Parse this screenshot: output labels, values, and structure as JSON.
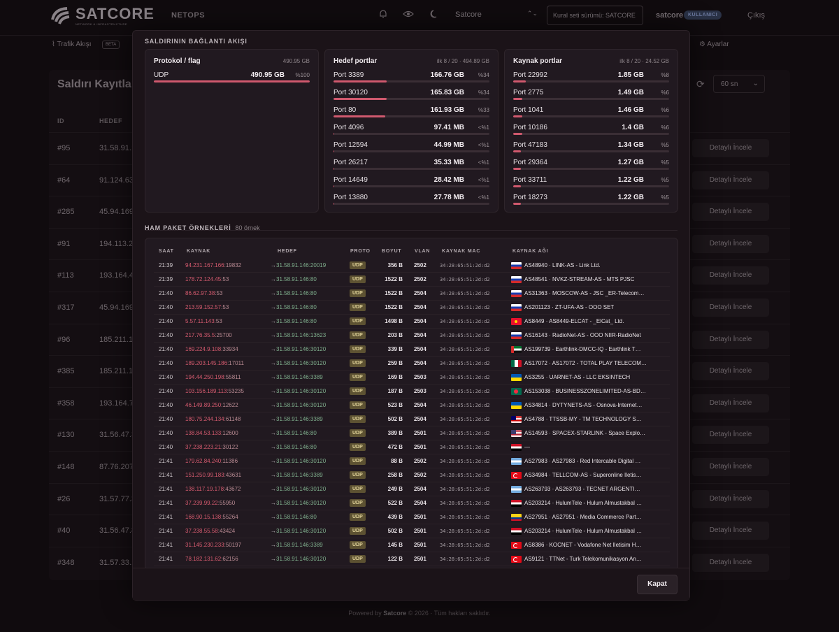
{
  "app": {
    "brand": "SATCORE",
    "brand_tagline": "NETWORK & INFRASTRUCTURE",
    "section": "NETOPS",
    "tenant": "Satcore",
    "ruleset": "Kural seti sürümü: SATCORE",
    "user": "satcore",
    "user_role": "KULLANICI",
    "logout": "Çıkış"
  },
  "subnav": {
    "traffic": "Trafik Akışı",
    "beta": "BETA",
    "settings": "Ayarlar"
  },
  "page": {
    "title": "Saldırı Kayıtları",
    "interval": "60 sn",
    "columns": [
      "ID",
      "HEDEF"
    ],
    "detail_label": "Detaylı İncele",
    "rows": [
      {
        "id": "#95",
        "ip": "31.58.91.1"
      },
      {
        "id": "#64",
        "ip": "91.124.63."
      },
      {
        "id": "#285",
        "ip": "45.94.169"
      },
      {
        "id": "#91",
        "ip": "194.113.22"
      },
      {
        "id": "#113",
        "ip": "193.164.4."
      },
      {
        "id": "#317",
        "ip": "45.94.169"
      },
      {
        "id": "#96",
        "ip": "185.211.10"
      },
      {
        "id": "#385",
        "ip": "185.211.10"
      },
      {
        "id": "#358",
        "ip": "193.164.7."
      },
      {
        "id": "#130",
        "ip": "31.56.47.3"
      },
      {
        "id": "#148",
        "ip": "87.76.207."
      },
      {
        "id": "#26",
        "ip": "31.57.77.3"
      },
      {
        "id": "#40",
        "ip": "31.56.47.8"
      },
      {
        "id": "#348",
        "ip": "31.57.33.1"
      }
    ]
  },
  "footer": {
    "prefix": "Powered by",
    "brand": "Satcore",
    "suffix": "© 2026 · Tüm hakları saklıdır."
  },
  "modal": {
    "flow_title": "SALDIRININ BAĞLANTI AKIŞI",
    "close_label": "Kapat",
    "protocol_card": {
      "title": "Protokol / flag",
      "meta": "490.95 GB",
      "rows": [
        {
          "label": "UDP",
          "value": "490.95 GB",
          "pct": "%100",
          "fraction": 1.0
        }
      ]
    },
    "dest_ports_card": {
      "title": "Hedef portlar",
      "meta": "ilk 8 / 20 · 494.89 GB",
      "rows": [
        {
          "label": "Port 3389",
          "value": "166.76 GB",
          "pct": "%34",
          "fraction": 0.34
        },
        {
          "label": "Port 30120",
          "value": "165.83 GB",
          "pct": "%34",
          "fraction": 0.34
        },
        {
          "label": "Port 80",
          "value": "161.93 GB",
          "pct": "%33",
          "fraction": 0.33
        },
        {
          "label": "Port 4096",
          "value": "97.41 MB",
          "pct": "<%1",
          "fraction": 0.005
        },
        {
          "label": "Port 12594",
          "value": "44.99 MB",
          "pct": "<%1",
          "fraction": 0.005
        },
        {
          "label": "Port 26217",
          "value": "35.33 MB",
          "pct": "<%1",
          "fraction": 0.005
        },
        {
          "label": "Port 14649",
          "value": "28.42 MB",
          "pct": "<%1",
          "fraction": 0.005
        },
        {
          "label": "Port 13880",
          "value": "27.78 MB",
          "pct": "<%1",
          "fraction": 0.005
        }
      ]
    },
    "src_ports_card": {
      "title": "Kaynak portlar",
      "meta": "ilk 8 / 20 · 24.52 GB",
      "rows": [
        {
          "label": "Port 22992",
          "value": "1.85 GB",
          "pct": "%8",
          "fraction": 0.08
        },
        {
          "label": "Port 2775",
          "value": "1.49 GB",
          "pct": "%6",
          "fraction": 0.06
        },
        {
          "label": "Port 1041",
          "value": "1.46 GB",
          "pct": "%6",
          "fraction": 0.06
        },
        {
          "label": "Port 10186",
          "value": "1.4 GB",
          "pct": "%6",
          "fraction": 0.06
        },
        {
          "label": "Port 47183",
          "value": "1.34 GB",
          "pct": "%5",
          "fraction": 0.05
        },
        {
          "label": "Port 29364",
          "value": "1.27 GB",
          "pct": "%5",
          "fraction": 0.05
        },
        {
          "label": "Port 33711",
          "value": "1.22 GB",
          "pct": "%5",
          "fraction": 0.05
        },
        {
          "label": "Port 18273",
          "value": "1.22 GB",
          "pct": "%5",
          "fraction": 0.05
        }
      ]
    },
    "packets_title": "HAM PAKET ÖRNEKLERİ",
    "packets_count": "80 örnek",
    "packet_columns": {
      "time": "SAAT",
      "src": "KAYNAK",
      "dst": "HEDEF",
      "proto": "PROTO",
      "size": "BOYUT",
      "vlan": "VLAN",
      "mac": "KAYNAK MAC",
      "asn": "KAYNAK AĞI"
    },
    "packets": [
      {
        "time": "21:39",
        "ip": "94.231.167.166",
        "port": ":19832",
        "dst": "31.58.91.146:20019",
        "proto": "UDP",
        "size": "356 B",
        "vlan": "2502",
        "mac": "34:28:65:51:2d:d2",
        "flag": "ru",
        "asn": "AS48940 · LINK-AS - Link Ltd."
      },
      {
        "time": "21:39",
        "ip": "178.72.124.45",
        "port": ":53",
        "dst": "31.58.91.146:80",
        "proto": "UDP",
        "size": "1522 B",
        "vlan": "2502",
        "mac": "34:28:65:51:2d:d2",
        "flag": "ru",
        "asn": "AS48541 · NVKZ-STREAM-AS - MTS PJSC"
      },
      {
        "time": "21:40",
        "ip": "86.62.97.38",
        "port": ":53",
        "dst": "31.58.91.146:80",
        "proto": "UDP",
        "size": "1522 B",
        "vlan": "2504",
        "mac": "34:28:65:51:2d:d2",
        "flag": "ru",
        "asn": "AS31363 · MOSCOW-AS - JSC _ER-Telecom…"
      },
      {
        "time": "21:40",
        "ip": "213.59.152.57",
        "port": ":53",
        "dst": "31.58.91.146:80",
        "proto": "UDP",
        "size": "1522 B",
        "vlan": "2504",
        "mac": "34:28:65:51:2d:d2",
        "flag": "ru",
        "asn": "AS201123 · ZT-UFA-AS - OOO SET"
      },
      {
        "time": "21:40",
        "ip": "5.57.11.143",
        "port": ":53",
        "dst": "31.58.91.146:80",
        "proto": "UDP",
        "size": "1498 B",
        "vlan": "2504",
        "mac": "34:28:65:51:2d:d2",
        "flag": "kg",
        "asn": "AS8449 · AS8449-ELCAT - _ElCat_ Ltd."
      },
      {
        "time": "21:40",
        "ip": "217.76.35.5",
        "port": ":25700",
        "dst": "31.58.91.146:13623",
        "proto": "UDP",
        "size": "203 B",
        "vlan": "2504",
        "mac": "34:28:65:51:2d:d2",
        "flag": "ru",
        "asn": "AS16143 · RadioNet-AS - OOO NIIR-RadioNet"
      },
      {
        "time": "21:40",
        "ip": "169.224.9.108",
        "port": ":33934",
        "dst": "31.58.91.146:30120",
        "proto": "UDP",
        "size": "339 B",
        "vlan": "2504",
        "mac": "34:28:65:51:2d:d2",
        "flag": "ae",
        "asn": "AS199739 · Earthlink-DMCC-IQ - Earthlink T…"
      },
      {
        "time": "21:40",
        "ip": "189.203.145.186",
        "port": ":17011",
        "dst": "31.58.91.146:30120",
        "proto": "UDP",
        "size": "259 B",
        "vlan": "2504",
        "mac": "34:28:65:51:2d:d2",
        "flag": "mx",
        "asn": "AS17072 · AS17072 - TOTAL PLAY TELECOM…"
      },
      {
        "time": "21:40",
        "ip": "194.44.250.198",
        "port": ":55811",
        "dst": "31.58.91.146:3389",
        "proto": "UDP",
        "size": "169 B",
        "vlan": "2503",
        "mac": "34:28:65:51:2d:d2",
        "flag": "ua",
        "asn": "AS3255 · UARNET-AS - LLC EKSINTECH"
      },
      {
        "time": "21:40",
        "ip": "103.156.189.113",
        "port": ":53235",
        "dst": "31.58.91.146:30120",
        "proto": "UDP",
        "size": "187 B",
        "vlan": "2503",
        "mac": "34:28:65:51:2d:d2",
        "flag": "bd",
        "asn": "AS153038 · BUSINESSZONELIMITED-AS-BD…"
      },
      {
        "time": "21:40",
        "ip": "46.149.89.250",
        "port": ":12622",
        "dst": "31.58.91.146:30120",
        "proto": "UDP",
        "size": "523 B",
        "vlan": "2504",
        "mac": "34:28:65:51:2d:d2",
        "flag": "ua",
        "asn": "AS34814 · DYTYNETS-AS - Osnova-Internet…"
      },
      {
        "time": "21:40",
        "ip": "180.75.244.134",
        "port": ":61148",
        "dst": "31.58.91.146:3389",
        "proto": "UDP",
        "size": "502 B",
        "vlan": "2504",
        "mac": "34:28:65:51:2d:d2",
        "flag": "my",
        "asn": "AS4788 · TTSSB-MY - TM TECHNOLOGY S…"
      },
      {
        "time": "21:40",
        "ip": "138.84.53.133",
        "port": ":12600",
        "dst": "31.58.91.146:80",
        "proto": "UDP",
        "size": "389 B",
        "vlan": "2501",
        "mac": "34:28:65:51:2d:d2",
        "flag": "us",
        "asn": "AS14593 · SPACEX-STARLINK - Space Explo…"
      },
      {
        "time": "21:40",
        "ip": "37.238.223.21",
        "port": ":30122",
        "dst": "31.58.91.146:80",
        "proto": "UDP",
        "size": "472 B",
        "vlan": "2501",
        "mac": "34:28:65:51:2d:d2",
        "flag": "eg",
        "asn": "—"
      },
      {
        "time": "21:41",
        "ip": "179.62.84.240",
        "port": ":11386",
        "dst": "31.58.91.146:30120",
        "proto": "UDP",
        "size": "88 B",
        "vlan": "2502",
        "mac": "34:28:65:51:2d:d2",
        "flag": "ar",
        "asn": "AS27983 · AS27983 - Red Intercable Digital …"
      },
      {
        "time": "21:41",
        "ip": "151.250.99.183",
        "port": ":43631",
        "dst": "31.58.91.146:3389",
        "proto": "UDP",
        "size": "258 B",
        "vlan": "2502",
        "mac": "34:28:65:51:2d:d2",
        "flag": "tr",
        "asn": "AS34984 · TELLCOM-AS - Superonline Iletis…"
      },
      {
        "time": "21:41",
        "ip": "138.117.19.178",
        "port": ":43672",
        "dst": "31.58.91.146:30120",
        "proto": "UDP",
        "size": "249 B",
        "vlan": "2504",
        "mac": "34:28:65:51:2d:d2",
        "flag": "ar",
        "asn": "AS263793 · AS263793 - TECNET ARGENTI…"
      },
      {
        "time": "21:41",
        "ip": "37.239.99.22",
        "port": ":55950",
        "dst": "31.58.91.146:30120",
        "proto": "UDP",
        "size": "522 B",
        "vlan": "2504",
        "mac": "34:28:65:51:2d:d2",
        "flag": "eg",
        "asn": "AS203214 · HulumTele - Hulum Almustakbal …"
      },
      {
        "time": "21:41",
        "ip": "168.90.15.138",
        "port": ":55264",
        "dst": "31.58.91.146:80",
        "proto": "UDP",
        "size": "439 B",
        "vlan": "2501",
        "mac": "34:28:65:51:2d:d2",
        "flag": "co",
        "asn": "AS27951 · AS27951 - Media Commerce Part…"
      },
      {
        "time": "21:41",
        "ip": "37.238.55.58",
        "port": ":43424",
        "dst": "31.58.91.146:30120",
        "proto": "UDP",
        "size": "502 B",
        "vlan": "2501",
        "mac": "34:28:65:51:2d:d2",
        "flag": "eg",
        "asn": "AS203214 · HulumTele - Hulum Almustakbal …"
      },
      {
        "time": "21:41",
        "ip": "31.145.230.233",
        "port": ":50197",
        "dst": "31.58.91.146:3389",
        "proto": "UDP",
        "size": "145 B",
        "vlan": "2501",
        "mac": "34:28:65:51:2d:d2",
        "flag": "tr",
        "asn": "AS8386 · KOCNET - Vodafone Net Iletisim H…"
      },
      {
        "time": "21:41",
        "ip": "78.182.131.62",
        "port": ":62156",
        "dst": "31.58.91.146:30120",
        "proto": "UDP",
        "size": "122 B",
        "vlan": "2501",
        "mac": "34:28:65:51:2d:d2",
        "flag": "tr",
        "asn": "AS9121 · TTNet - Turk Telekomunikasyon An…"
      }
    ]
  },
  "colors": {
    "accent": "#d0596e",
    "source_ip": "#d45a6e",
    "dest_ip": "#7fae8c",
    "proto_badge": "#5d5232"
  }
}
